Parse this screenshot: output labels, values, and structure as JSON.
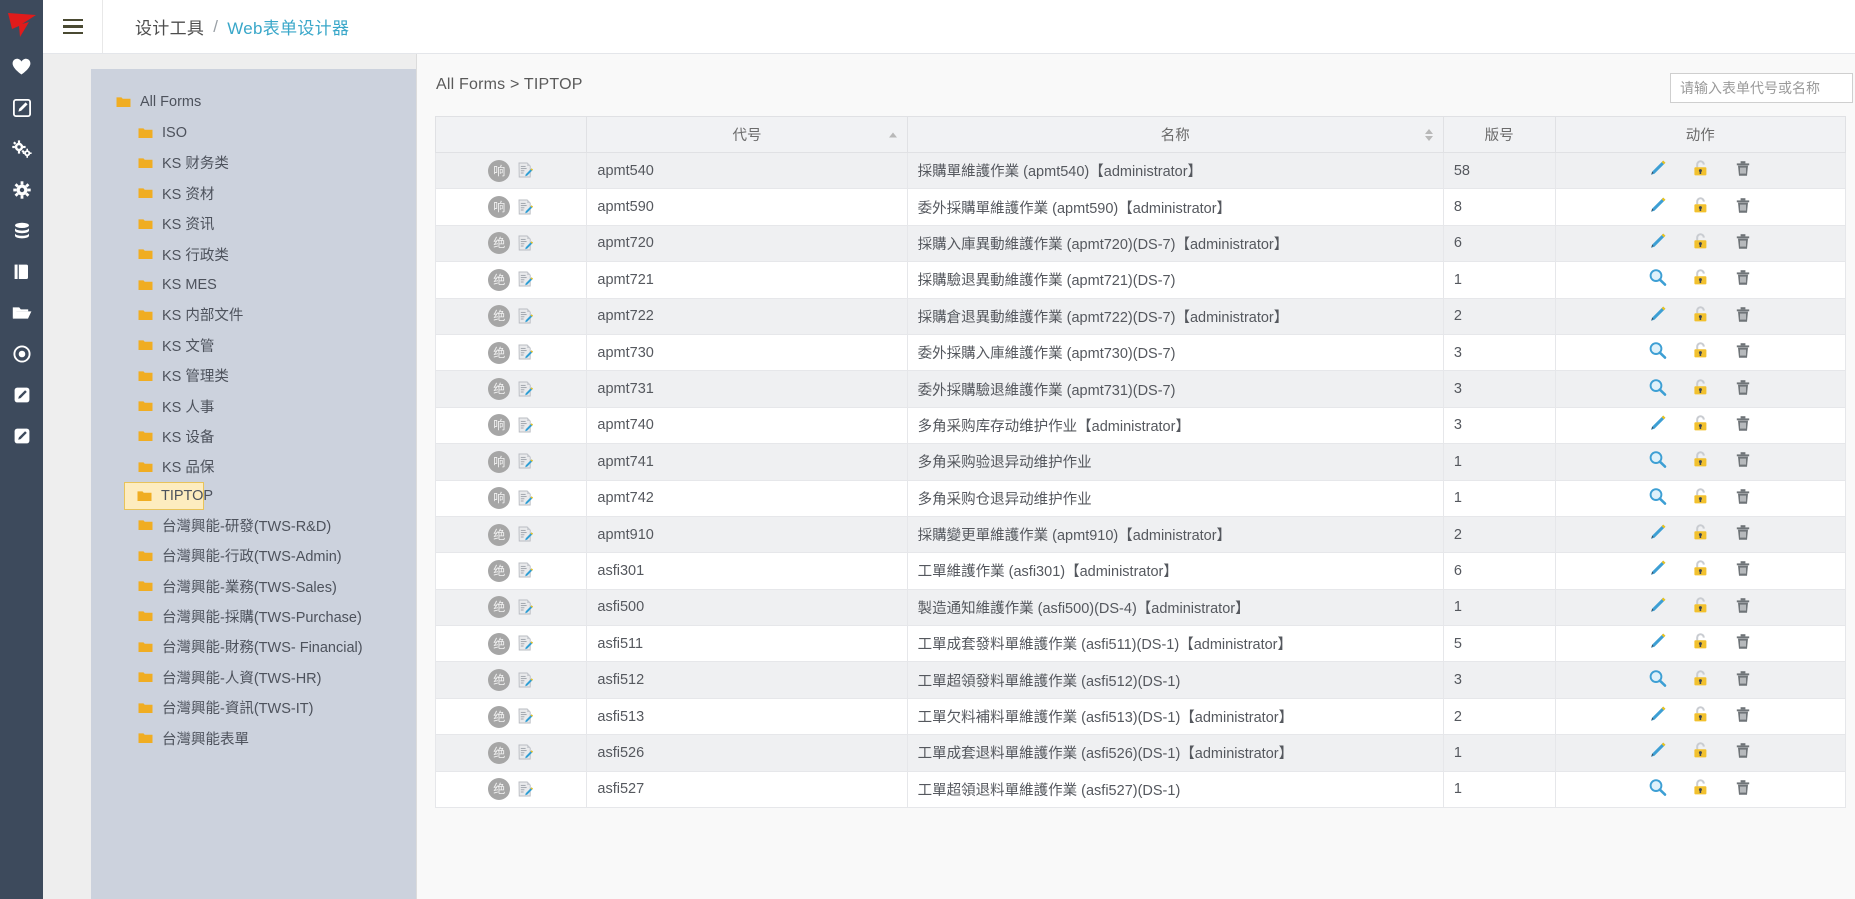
{
  "topbar": {
    "menu_icon": "hamburger-icon",
    "breadcrumb_root": "设计工具",
    "breadcrumb_sep": "/",
    "breadcrumb_current": "Web表单设计器"
  },
  "rail": {
    "logo": "brand-logo",
    "items": [
      {
        "icon": "heart-icon"
      },
      {
        "icon": "edit-square-icon"
      },
      {
        "icon": "gears-icon"
      },
      {
        "icon": "gear-icon"
      },
      {
        "icon": "database-icon"
      },
      {
        "icon": "book-icon"
      },
      {
        "icon": "folder-open-icon"
      },
      {
        "icon": "target-circle-icon"
      },
      {
        "icon": "pencil-square-icon"
      },
      {
        "icon": "pencil-square-icon-2"
      }
    ]
  },
  "tree": {
    "items": [
      {
        "label": "All Forms",
        "level": 0,
        "selected": false
      },
      {
        "label": "ISO",
        "level": 1,
        "selected": false
      },
      {
        "label": "KS 财务类",
        "level": 1,
        "selected": false
      },
      {
        "label": "KS 资材",
        "level": 1,
        "selected": false
      },
      {
        "label": "KS 资讯",
        "level": 1,
        "selected": false
      },
      {
        "label": "KS 行政类",
        "level": 1,
        "selected": false
      },
      {
        "label": "KS MES",
        "level": 1,
        "selected": false
      },
      {
        "label": "KS 内部文件",
        "level": 1,
        "selected": false
      },
      {
        "label": "KS 文管",
        "level": 1,
        "selected": false
      },
      {
        "label": "KS 管理类",
        "level": 1,
        "selected": false
      },
      {
        "label": "KS 人事",
        "level": 1,
        "selected": false
      },
      {
        "label": "KS 设备",
        "level": 1,
        "selected": false
      },
      {
        "label": "KS 品保",
        "level": 1,
        "selected": false
      },
      {
        "label": "TIPTOP",
        "level": 1,
        "selected": true
      },
      {
        "label": "台灣興能-研發(TWS-R&D)",
        "level": 1,
        "selected": false
      },
      {
        "label": "台灣興能-行政(TWS-Admin)",
        "level": 1,
        "selected": false
      },
      {
        "label": "台灣興能-業務(TWS-Sales)",
        "level": 1,
        "selected": false
      },
      {
        "label": "台灣興能-採購(TWS-Purchase)",
        "level": 1,
        "selected": false
      },
      {
        "label": "台灣興能-財務(TWS- Financial)",
        "level": 1,
        "selected": false
      },
      {
        "label": "台灣興能-人資(TWS-HR)",
        "level": 1,
        "selected": false
      },
      {
        "label": "台灣興能-資訊(TWS-IT)",
        "level": 1,
        "selected": false
      },
      {
        "label": "台灣興能表單",
        "level": 1,
        "selected": false
      }
    ]
  },
  "content": {
    "breadcrumb": "All Forms > TIPTOP",
    "search_placeholder": "请输入表单代号或名称",
    "search_value": ""
  },
  "table": {
    "headers": {
      "icons": "",
      "code": "代号",
      "name": "名称",
      "version": "版号",
      "action": "动作"
    },
    "sort": {
      "code": "asc",
      "name": "none"
    },
    "rows": [
      {
        "badge": "响",
        "code": "apmt540",
        "name": "採購單維護作業 (apmt540)【administrator】",
        "version": "58",
        "first_action": "pencil-icon"
      },
      {
        "badge": "响",
        "code": "apmt590",
        "name": "委外採購單維護作業 (apmt590)【administrator】",
        "version": "8",
        "first_action": "pencil-icon"
      },
      {
        "badge": "绝",
        "code": "apmt720",
        "name": "採購入庫異動維護作業 (apmt720)(DS-7)【administrator】",
        "version": "6",
        "first_action": "pencil-icon"
      },
      {
        "badge": "绝",
        "code": "apmt721",
        "name": "採購驗退異動維護作業 (apmt721)(DS-7)",
        "version": "1",
        "first_action": "magnifier-icon"
      },
      {
        "badge": "绝",
        "code": "apmt722",
        "name": "採購倉退異動維護作業 (apmt722)(DS-7)【administrator】",
        "version": "2",
        "first_action": "pencil-icon"
      },
      {
        "badge": "绝",
        "code": "apmt730",
        "name": "委外採購入庫維護作業 (apmt730)(DS-7)",
        "version": "3",
        "first_action": "magnifier-icon"
      },
      {
        "badge": "绝",
        "code": "apmt731",
        "name": "委外採購驗退維護作業 (apmt731)(DS-7)",
        "version": "3",
        "first_action": "magnifier-icon"
      },
      {
        "badge": "响",
        "code": "apmt740",
        "name": "多角采购库存动维护作业【administrator】",
        "version": "3",
        "first_action": "pencil-icon"
      },
      {
        "badge": "响",
        "code": "apmt741",
        "name": "多角采购验退异动维护作业",
        "version": "1",
        "first_action": "magnifier-icon"
      },
      {
        "badge": "响",
        "code": "apmt742",
        "name": "多角采购仓退异动维护作业",
        "version": "1",
        "first_action": "magnifier-icon"
      },
      {
        "badge": "绝",
        "code": "apmt910",
        "name": "採購變更單維護作業 (apmt910)【administrator】",
        "version": "2",
        "first_action": "pencil-icon"
      },
      {
        "badge": "绝",
        "code": "asfi301",
        "name": "工單維護作業 (asfi301)【administrator】",
        "version": "6",
        "first_action": "pencil-icon"
      },
      {
        "badge": "绝",
        "code": "asfi500",
        "name": "製造通知維護作業 (asfi500)(DS-4)【administrator】",
        "version": "1",
        "first_action": "pencil-icon"
      },
      {
        "badge": "绝",
        "code": "asfi511",
        "name": "工單成套發料單維護作業 (asfi511)(DS-1)【administrator】",
        "version": "5",
        "first_action": "pencil-icon"
      },
      {
        "badge": "绝",
        "code": "asfi512",
        "name": "工單超領發料單維護作業 (asfi512)(DS-1)",
        "version": "3",
        "first_action": "magnifier-icon"
      },
      {
        "badge": "绝",
        "code": "asfi513",
        "name": "工單欠料補料單維護作業 (asfi513)(DS-1)【administrator】",
        "version": "2",
        "first_action": "pencil-icon"
      },
      {
        "badge": "绝",
        "code": "asfi526",
        "name": "工單成套退料單維護作業 (asfi526)(DS-1)【administrator】",
        "version": "1",
        "first_action": "pencil-icon"
      },
      {
        "badge": "绝",
        "code": "asfi527",
        "name": "工單超領退料單維護作業 (asfi527)(DS-1)",
        "version": "1",
        "first_action": "magnifier-icon"
      }
    ],
    "action_icons": {
      "lock": "unlock-padlock-icon",
      "delete": "trash-icon"
    }
  },
  "colors": {
    "rail_bg": "#3d4a5c",
    "tree_bg": "#ccd2dd",
    "selected_bg": "#fdecbf",
    "selected_border": "#e8c35a",
    "folder": "#f0ad22",
    "link": "#39a7c9",
    "lock_yellow": "#f2c12e"
  }
}
